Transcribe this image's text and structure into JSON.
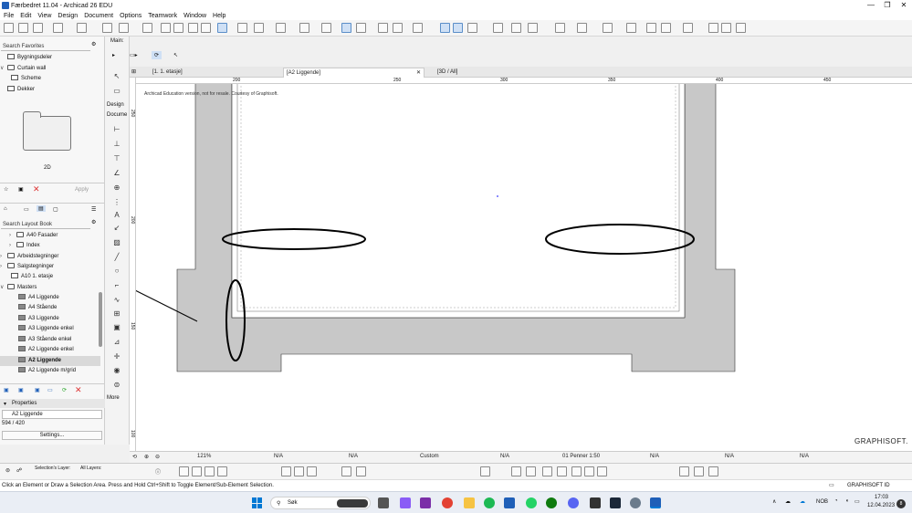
{
  "app": {
    "title": "Færbedret 11.04 - Archicad 26 EDU",
    "window_buttons": [
      "—",
      "❐",
      "✕"
    ]
  },
  "menu": [
    "File",
    "Edit",
    "View",
    "Design",
    "Document",
    "Options",
    "Teamwork",
    "Window",
    "Help"
  ],
  "sidebar": {
    "favorites_search_placeholder": "Search Favorites",
    "favorites": [
      {
        "label": "Bygningsdeler"
      },
      {
        "label": "Curtain wall"
      },
      {
        "label": "Scheme"
      },
      {
        "label": "Dekker"
      }
    ],
    "preview_label": "2D",
    "apply_label": "Apply",
    "layout_search_placeholder": "Search Layout Book",
    "layout_items": [
      {
        "label": "A40 Fasader"
      },
      {
        "label": "Index"
      },
      {
        "label": "Arbeidstegninger"
      },
      {
        "label": "Salgstegninger"
      },
      {
        "label": "A10 1. etasje"
      },
      {
        "label": "Masters"
      },
      {
        "label": "A4 Liggende"
      },
      {
        "label": "A4 Stående"
      },
      {
        "label": "A3 Liggende"
      },
      {
        "label": "A3 Liggende enkel"
      },
      {
        "label": "A3 Stående enkel"
      },
      {
        "label": "A2 Liggende enkel"
      },
      {
        "label": "A2 Liggende"
      },
      {
        "label": "A2 Liggende m/grid"
      }
    ],
    "properties_header": "Properties",
    "properties_name": "A2 Liggende",
    "properties_size": "594 / 420",
    "settings_label": "Settings..."
  },
  "toolbox": {
    "main_label": "Main:",
    "design_label": "Design",
    "document_label": "Docume",
    "more_label": "More"
  },
  "tabs": [
    {
      "label": "[1. 1. etasje]"
    },
    {
      "label": "[A2 Liggende]"
    },
    {
      "label": "[3D / All]"
    }
  ],
  "canvas": {
    "watermark": "Archicad Education version, not for resale. Courtesy of Graphisoft.",
    "brand": "GRAPHISOFT.",
    "ruler_top": [
      "200",
      "250",
      "300",
      "350",
      "400",
      "450"
    ],
    "ruler_left": [
      "250",
      "200",
      "150",
      "100"
    ]
  },
  "bottombar": {
    "zoom": "121%",
    "na": "N/A",
    "custom": "Custom",
    "pens": "01 Penner 1:50"
  },
  "infobar": {
    "selection_layer": "Selection's Layer:",
    "all_layers": "All Layers:"
  },
  "status": {
    "message": "Click an Element or Draw a Selection Area. Press and Hold Ctrl+Shift to Toggle Element/Sub-Element Selection.",
    "graphisoft_id": "GRAPHISOFT ID"
  },
  "taskbar": {
    "search": "Søk",
    "language": "NOB",
    "time": "17:03",
    "date": "12.04.2023"
  },
  "colors": {
    "wall_fill": "#c8c8c8",
    "annotation": "#000000",
    "accent": "#1f5fb8"
  }
}
